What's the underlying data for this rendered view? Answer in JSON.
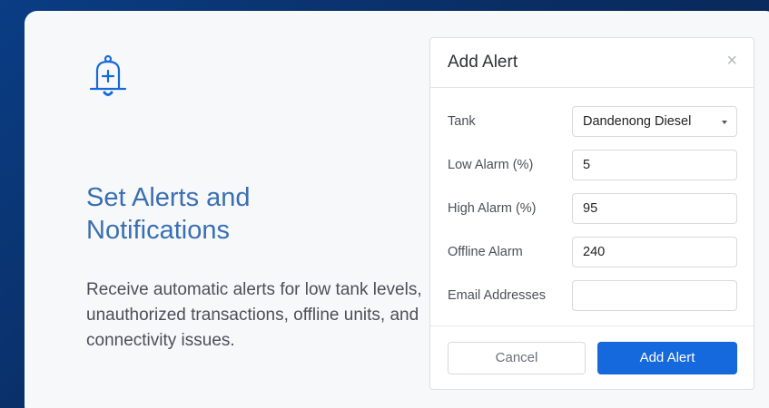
{
  "colors": {
    "accent": "#1669dc",
    "heading": "#3a6fb3",
    "background": "#0a3d84"
  },
  "feature": {
    "icon": "bell-plus-icon",
    "title": "Set Alerts and Notifications",
    "description": "Receive automatic alerts for low tank levels, unauthorized transactions, offline units, and connectivity issues."
  },
  "modal": {
    "title": "Add Alert",
    "close_icon": "close-icon",
    "fields": [
      {
        "label": "Tank",
        "value": "Dandenong Diesel",
        "type": "select"
      },
      {
        "label": "Low Alarm (%)",
        "value": "5",
        "type": "input"
      },
      {
        "label": "High Alarm (%)",
        "value": "95",
        "type": "input"
      },
      {
        "label": "Offline Alarm",
        "value": "240",
        "type": "input"
      },
      {
        "label": "Email Addresses",
        "value": "",
        "type": "input"
      }
    ],
    "cancel_label": "Cancel",
    "submit_label": "Add Alert"
  }
}
